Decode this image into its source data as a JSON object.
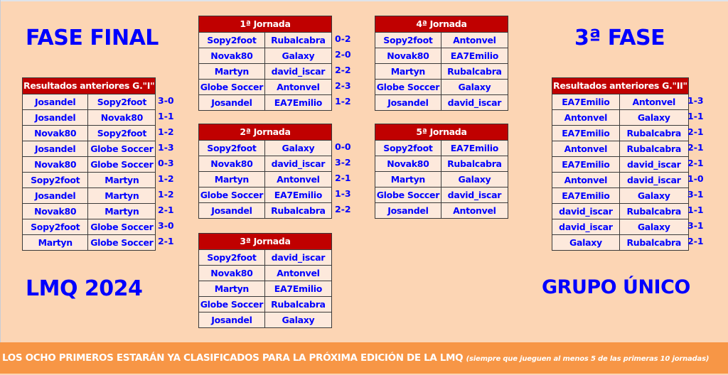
{
  "titles": {
    "fase_final": "FASE FINAL",
    "tercera_fase": "3ª FASE",
    "lmq": "LMQ 2024",
    "grupo": "GRUPO ÚNICO"
  },
  "previous_group_1": {
    "header": "Resultados anteriores G.\"I\"",
    "rows": [
      {
        "home": "Josandel",
        "away": "Sopy2foot",
        "score": "3-0"
      },
      {
        "home": "Josandel",
        "away": "Novak80",
        "score": "1-1"
      },
      {
        "home": "Novak80",
        "away": "Sopy2foot",
        "score": "1-2"
      },
      {
        "home": "Josandel",
        "away": "Globe Soccer",
        "score": "1-3"
      },
      {
        "home": "Novak80",
        "away": "Globe Soccer",
        "score": "0-3"
      },
      {
        "home": "Sopy2foot",
        "away": "Martyn",
        "score": "1-2"
      },
      {
        "home": "Josandel",
        "away": "Martyn",
        "score": "1-2"
      },
      {
        "home": "Novak80",
        "away": "Martyn",
        "score": "2-1"
      },
      {
        "home": "Sopy2foot",
        "away": "Globe Soccer",
        "score": "3-0"
      },
      {
        "home": "Martyn",
        "away": "Globe Soccer",
        "score": "2-1"
      }
    ]
  },
  "previous_group_2": {
    "header": "Resultados anteriores G.\"II\"",
    "rows": [
      {
        "home": "EA7Emilio",
        "away": "Antonvel",
        "score": "1-3"
      },
      {
        "home": "Antonvel",
        "away": "Galaxy",
        "score": "1-1"
      },
      {
        "home": "EA7Emilio",
        "away": "Rubalcabra",
        "score": "2-1"
      },
      {
        "home": "Antonvel",
        "away": "Rubalcabra",
        "score": "2-1"
      },
      {
        "home": "EA7Emilio",
        "away": "david_iscar",
        "score": "2-1"
      },
      {
        "home": "Antonvel",
        "away": "david_iscar",
        "score": "1-0"
      },
      {
        "home": "EA7Emilio",
        "away": "Galaxy",
        "score": "3-1"
      },
      {
        "home": "david_iscar",
        "away": "Rubalcabra",
        "score": "1-1"
      },
      {
        "home": "david_iscar",
        "away": "Galaxy",
        "score": "3-1"
      },
      {
        "home": "Galaxy",
        "away": "Rubalcabra",
        "score": "2-1"
      }
    ]
  },
  "jornadas": [
    {
      "header": "1ª Jornada",
      "rows": [
        {
          "home": "Sopy2foot",
          "away": "Rubalcabra",
          "score": "0-2"
        },
        {
          "home": "Novak80",
          "away": "Galaxy",
          "score": "2-0"
        },
        {
          "home": "Martyn",
          "away": "david_iscar",
          "score": "2-2"
        },
        {
          "home": "Globe Soccer",
          "away": "Antonvel",
          "score": "2-3"
        },
        {
          "home": "Josandel",
          "away": "EA7Emilio",
          "score": "1-2"
        }
      ]
    },
    {
      "header": "2ª Jornada",
      "rows": [
        {
          "home": "Sopy2foot",
          "away": "Galaxy",
          "score": "0-0"
        },
        {
          "home": "Novak80",
          "away": "david_iscar",
          "score": "3-2"
        },
        {
          "home": "Martyn",
          "away": "Antonvel",
          "score": "2-1"
        },
        {
          "home": "Globe Soccer",
          "away": "EA7Emilio",
          "score": "1-3"
        },
        {
          "home": "Josandel",
          "away": "Rubalcabra",
          "score": "2-2"
        }
      ]
    },
    {
      "header": "3ª Jornada",
      "rows": [
        {
          "home": "Sopy2foot",
          "away": "david_iscar",
          "score": ""
        },
        {
          "home": "Novak80",
          "away": "Antonvel",
          "score": ""
        },
        {
          "home": "Martyn",
          "away": "EA7Emilio",
          "score": ""
        },
        {
          "home": "Globe Soccer",
          "away": "Rubalcabra",
          "score": ""
        },
        {
          "home": "Josandel",
          "away": "Galaxy",
          "score": ""
        }
      ]
    },
    {
      "header": "4ª Jornada",
      "rows": [
        {
          "home": "Sopy2foot",
          "away": "Antonvel",
          "score": ""
        },
        {
          "home": "Novak80",
          "away": "EA7Emilio",
          "score": ""
        },
        {
          "home": "Martyn",
          "away": "Rubalcabra",
          "score": ""
        },
        {
          "home": "Globe Soccer",
          "away": "Galaxy",
          "score": ""
        },
        {
          "home": "Josandel",
          "away": "david_iscar",
          "score": ""
        }
      ]
    },
    {
      "header": "5ª Jornada",
      "rows": [
        {
          "home": "Sopy2foot",
          "away": "EA7Emilio",
          "score": ""
        },
        {
          "home": "Novak80",
          "away": "Rubalcabra",
          "score": ""
        },
        {
          "home": "Martyn",
          "away": "Galaxy",
          "score": ""
        },
        {
          "home": "Globe Soccer",
          "away": "david_iscar",
          "score": ""
        },
        {
          "home": "Josandel",
          "away": "Antonvel",
          "score": ""
        }
      ]
    }
  ],
  "footer": {
    "main": "LOS OCHO PRIMEROS ESTARÁN YA CLASIFICADOS PARA LA PRÓXIMA EDICIÓN DE LA LMQ",
    "note": "(siempre que jueguen al menos 5 de las primeras 10 jornadas)"
  },
  "colors": {
    "background": "#fcd5b4",
    "header_red": "#c00000",
    "cell_bg": "#fde9dc",
    "text_blue": "#0000ff",
    "footer_orange": "#f79646"
  }
}
